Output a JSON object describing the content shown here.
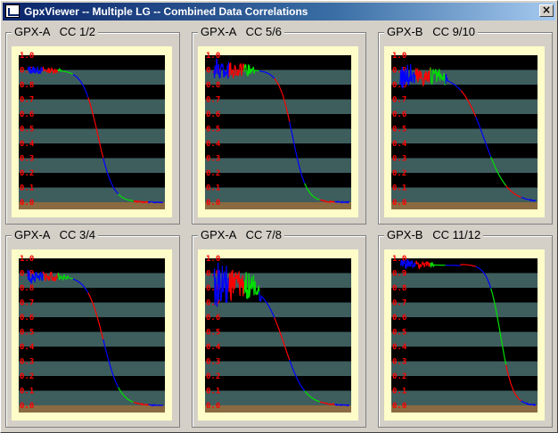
{
  "window": {
    "title": "GpxViewer -- Multiple LG -- Combined Data Correlations",
    "close_label": "×"
  },
  "panels": [
    {
      "title": "GPX-A   CC 1/2"
    },
    {
      "title": "GPX-A   CC 5/6"
    },
    {
      "title": "GPX-B   CC 9/10"
    },
    {
      "title": "GPX-A   CC 3/4"
    },
    {
      "title": "GPX-A   CC 7/8"
    },
    {
      "title": "GPX-B   CC 11/12"
    }
  ],
  "colors": {
    "band_dark": "#000000",
    "band_light": "#3e5e5e",
    "floor": "#8a6a40",
    "frame": "#fefcc8",
    "tick_text": "#ff0000",
    "line_blue": "#0000ff",
    "line_green": "#00e000",
    "line_red": "#ff0000"
  },
  "chart_data": [
    {
      "type": "line",
      "ylim": [
        0,
        1
      ],
      "yticks": [
        "1.0",
        "0.9",
        "0.8",
        "0.7",
        "0.6",
        "0.5",
        "0.4",
        "0.3",
        "0.2",
        "0.1",
        "0.0"
      ],
      "curve": {
        "start": 0.9,
        "plateau_end": 0.22,
        "mid": 0.52,
        "width": 0.055
      },
      "noise": {
        "end": 0.25,
        "amp": 0.03
      }
    },
    {
      "type": "line",
      "ylim": [
        0,
        1
      ],
      "yticks": [
        "1.0",
        "0.9",
        "0.8",
        "0.7",
        "0.6",
        "0.5",
        "0.4",
        "0.3",
        "0.2",
        "0.1",
        "0.0"
      ],
      "curve": {
        "start": 0.9,
        "plateau_end": 0.25,
        "mid": 0.58,
        "width": 0.05
      },
      "noise": {
        "end": 0.3,
        "amp": 0.08
      }
    },
    {
      "type": "line",
      "ylim": [
        0,
        1
      ],
      "yticks": [
        "1.0",
        "0.9",
        "0.8",
        "0.7",
        "0.6",
        "0.5",
        "0.4",
        "0.3",
        "0.2",
        "0.1",
        "0.0"
      ],
      "curve": {
        "start": 0.86,
        "plateau_end": 0.3,
        "mid": 0.62,
        "width": 0.085
      },
      "noise": {
        "end": 0.35,
        "amp": 0.1
      }
    },
    {
      "type": "line",
      "ylim": [
        0,
        1
      ],
      "yticks": [
        "1.0",
        "0.9",
        "0.8",
        "0.7",
        "0.6",
        "0.5",
        "0.4",
        "0.3",
        "0.2",
        "0.1",
        "0.0"
      ],
      "curve": {
        "start": 0.88,
        "plateau_end": 0.28,
        "mid": 0.56,
        "width": 0.06
      },
      "noise": {
        "end": 0.3,
        "amp": 0.05
      }
    },
    {
      "type": "line",
      "ylim": [
        0,
        1
      ],
      "yticks": [
        "1.0",
        "0.9",
        "0.8",
        "0.7",
        "0.6",
        "0.5",
        "0.4",
        "0.3",
        "0.2",
        "0.1",
        "0.0"
      ],
      "curve": {
        "start": 0.82,
        "plateau_end": 0.33,
        "mid": 0.52,
        "width": 0.075
      },
      "noise": {
        "end": 0.35,
        "amp": 0.16
      }
    },
    {
      "type": "line",
      "ylim": [
        0,
        1
      ],
      "yticks": [
        "1.0",
        "0.9",
        "0.8",
        "0.7",
        "0.6",
        "0.5",
        "0.4",
        "0.3",
        "0.2",
        "0.1",
        "0.0"
      ],
      "curve": {
        "start": 0.96,
        "plateau_end": 0.45,
        "mid": 0.74,
        "width": 0.045
      },
      "noise": {
        "end": 0.25,
        "amp": 0.04
      }
    }
  ]
}
